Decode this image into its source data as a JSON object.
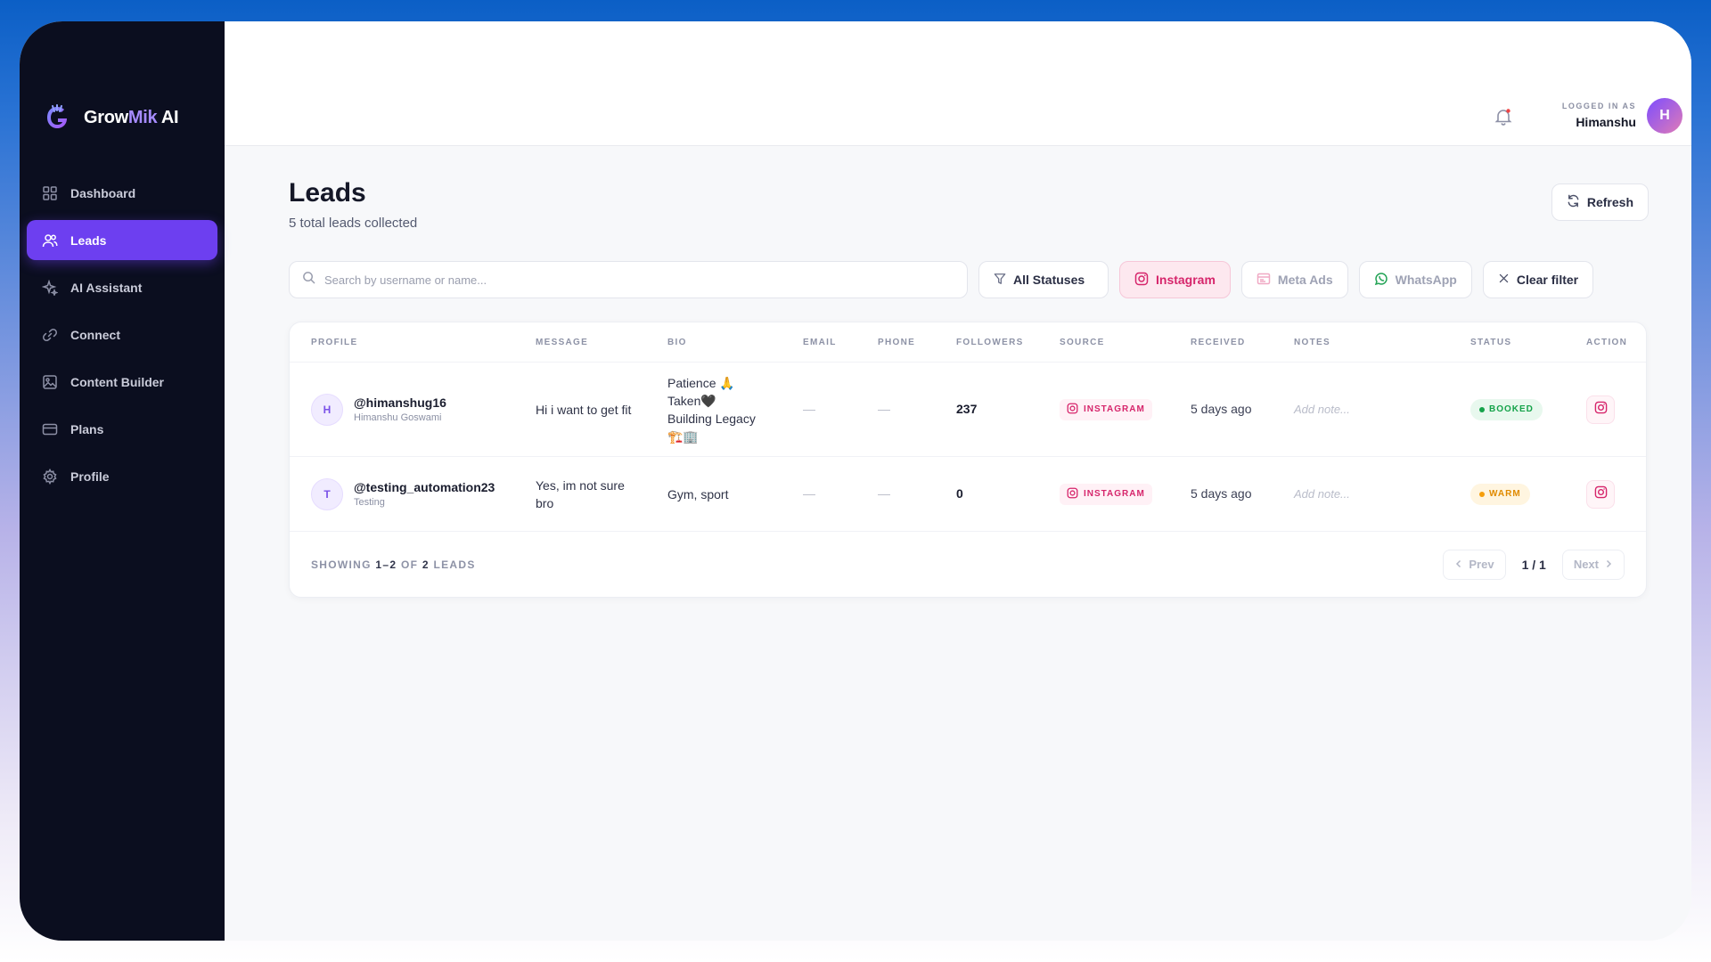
{
  "brand": {
    "name_part1": "Grow",
    "name_part2": "Mik",
    "name_part3": " AI"
  },
  "sidebar": {
    "items": [
      {
        "label": "Dashboard",
        "icon": "grid-icon"
      },
      {
        "label": "Leads",
        "icon": "users-icon",
        "active": true
      },
      {
        "label": "AI Assistant",
        "icon": "sparkle-icon"
      },
      {
        "label": "Connect",
        "icon": "link-icon"
      },
      {
        "label": "Content Builder",
        "icon": "image-icon"
      },
      {
        "label": "Plans",
        "icon": "card-icon"
      },
      {
        "label": "Profile",
        "icon": "gear-icon"
      }
    ]
  },
  "header": {
    "logged_in_label": "LOGGED IN AS",
    "user_name": "Himanshu",
    "avatar_initial": "H"
  },
  "page": {
    "title": "Leads",
    "subtitle": "5 total leads collected",
    "refresh_label": "Refresh"
  },
  "filters": {
    "search_placeholder": "Search by username or name...",
    "status_label": "All Statuses",
    "instagram_label": "Instagram",
    "meta_label": "Meta Ads",
    "whatsapp_label": "WhatsApp",
    "clear_label": "Clear filter"
  },
  "table": {
    "headers": [
      "PROFILE",
      "MESSAGE",
      "BIO",
      "EMAIL",
      "PHONE",
      "FOLLOWERS",
      "SOURCE",
      "RECEIVED",
      "NOTES",
      "STATUS",
      "ACTION"
    ],
    "rows": [
      {
        "initial": "H",
        "handle": "@himanshug16",
        "name": "Himanshu Goswami",
        "message": "Hi i want to get fit",
        "bio": [
          "Patience 🙏",
          "Taken🖤",
          "Building Legacy",
          "🏗️🏢"
        ],
        "email": "—",
        "phone": "—",
        "followers": "237",
        "source": "INSTAGRAM",
        "received": "5 days ago",
        "notes_placeholder": "Add note...",
        "status": "BOOKED"
      },
      {
        "initial": "T",
        "handle": "@testing_automation23",
        "name": "Testing",
        "message": "Yes, im not sure bro",
        "bio": [
          "Gym, sport"
        ],
        "email": "—",
        "phone": "—",
        "followers": "0",
        "source": "INSTAGRAM",
        "received": "5 days ago",
        "notes_placeholder": "Add note...",
        "status": "WARM"
      }
    ]
  },
  "pagination": {
    "showing_prefix": "SHOWING",
    "showing_range": "1–2",
    "showing_of": "OF",
    "showing_total": "2",
    "showing_suffix": "LEADS",
    "prev_label": "Prev",
    "page_indicator": "1 / 1",
    "next_label": "Next"
  },
  "colors": {
    "accent": "#6d3ff0",
    "instagram": "#d6256b",
    "booked": "#15a34a",
    "warm": "#e08a00",
    "sidebar_bg": "#0b0e1f"
  }
}
